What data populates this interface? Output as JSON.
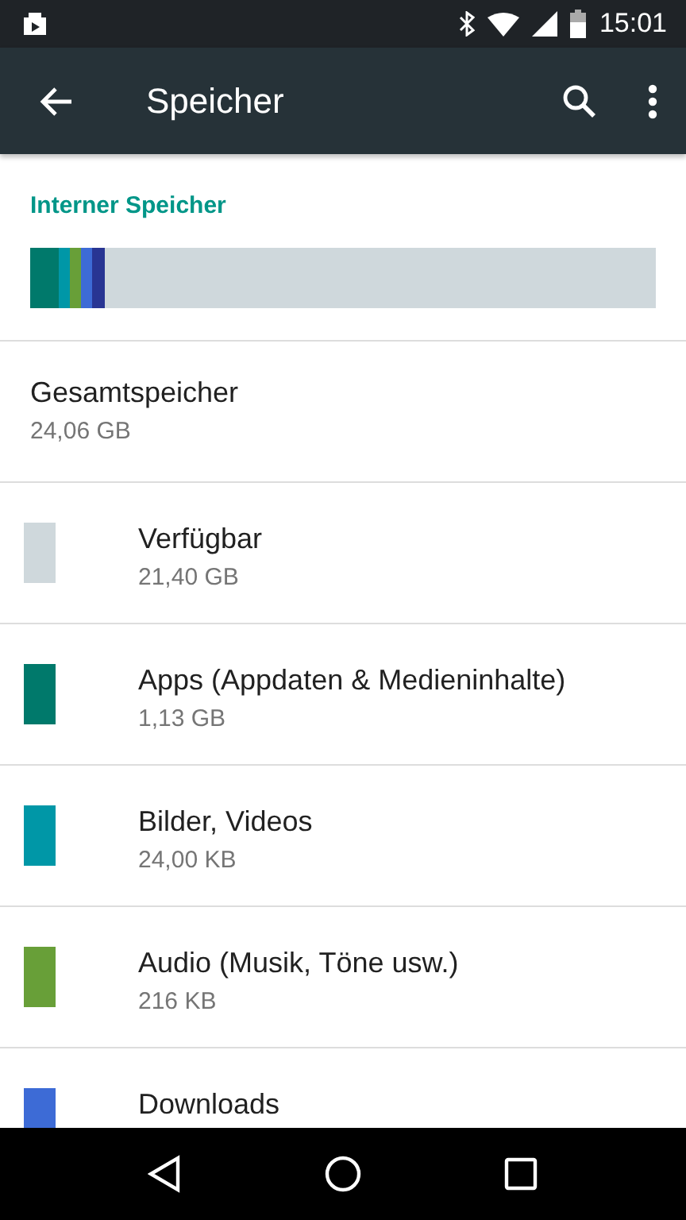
{
  "status_bar": {
    "time": "15:01"
  },
  "toolbar": {
    "title": "Speicher"
  },
  "section": {
    "title": "Interner Speicher"
  },
  "usage_bar": {
    "segments": [
      {
        "color": "#00796b"
      },
      {
        "color": "#0097a7"
      },
      {
        "color": "#689f38"
      },
      {
        "color": "#3d6bd6"
      },
      {
        "color": "#283593"
      }
    ]
  },
  "total": {
    "label": "Gesamtspeicher",
    "value": "24,06 GB"
  },
  "items": [
    {
      "label": "Verfügbar",
      "value": "21,40 GB",
      "color": "#cfd8dc"
    },
    {
      "label": "Apps (Appdaten & Medieninhalte)",
      "value": "1,13 GB",
      "color": "#00796b"
    },
    {
      "label": "Bilder, Videos",
      "value": "24,00 KB",
      "color": "#0097a7"
    },
    {
      "label": "Audio (Musik, Töne usw.)",
      "value": "216 KB",
      "color": "#689f38"
    },
    {
      "label": "Downloads",
      "color": "#3d6bd6"
    }
  ]
}
